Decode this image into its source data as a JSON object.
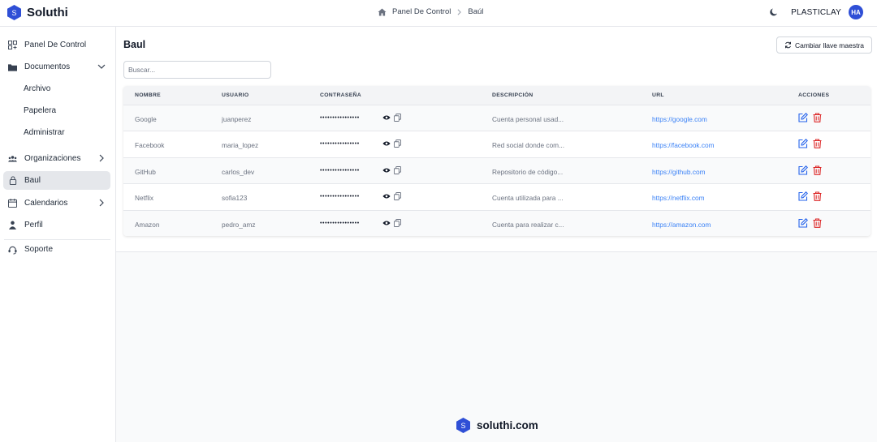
{
  "header": {
    "brand": "Soluthi",
    "logo_letter": "S",
    "breadcrumb": {
      "home": "Panel De Control",
      "current": "Baúl"
    },
    "username": "PLASTICLAY",
    "avatar_initials": "HA"
  },
  "sidebar": {
    "items": [
      {
        "label": "Panel De Control",
        "icon": "dashboard-icon"
      },
      {
        "label": "Documentos",
        "icon": "folder-icon"
      },
      {
        "label": "Archivo"
      },
      {
        "label": "Papelera"
      },
      {
        "label": "Administrar"
      },
      {
        "label": "Organizaciones",
        "icon": "users-icon"
      },
      {
        "label": "Baul",
        "icon": "lock-icon"
      },
      {
        "label": "Calendarios",
        "icon": "calendar-icon"
      },
      {
        "label": "Perfil",
        "icon": "user-icon"
      },
      {
        "label": "Soporte",
        "icon": "support-icon"
      }
    ]
  },
  "main": {
    "title": "Baul",
    "change_key_label": "Cambiar llave maestra",
    "search_placeholder": "Buscar...",
    "columns": [
      "NOMBRE",
      "USUARIO",
      "CONTRASEÑA",
      "DESCRIPCIÓN",
      "URL",
      "ACCIONES"
    ],
    "rows": [
      {
        "name": "Google",
        "user": "juanperez",
        "password": "••••••••••••••••",
        "description": "Cuenta personal usad...",
        "url": "https://google.com"
      },
      {
        "name": "Facebook",
        "user": "maria_lopez",
        "password": "••••••••••••••••",
        "description": "Red social donde com...",
        "url": "https://facebook.com"
      },
      {
        "name": "GitHub",
        "user": "carlos_dev",
        "password": "••••••••••••••••",
        "description": "Repositorio de código...",
        "url": "https://github.com"
      },
      {
        "name": "Netflix",
        "user": "sofia123",
        "password": "••••••••••••••••",
        "description": "Cuenta utilizada para ...",
        "url": "https://netflix.com"
      },
      {
        "name": "Amazon",
        "user": "pedro_amz",
        "password": "••••••••••••••••",
        "description": "Cuenta para realizar c...",
        "url": "https://amazon.com"
      }
    ]
  },
  "footer": {
    "brand": "soluthi.com"
  },
  "colors": {
    "accent": "#2f4fd6",
    "link": "#3b82f6",
    "danger": "#dc2626",
    "edit": "#2563eb"
  }
}
